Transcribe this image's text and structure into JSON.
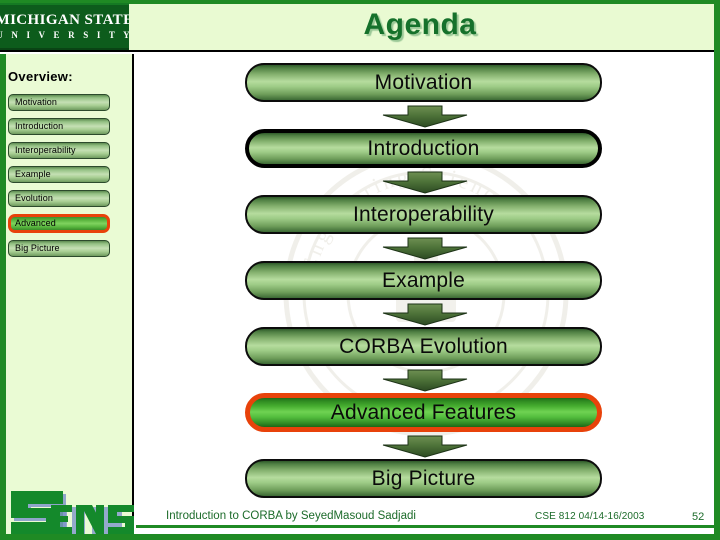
{
  "header": {
    "title": "Agenda",
    "logo": {
      "line1": "MICHIGAN STATE",
      "line2": "U N I V E R S I T Y",
      "alt": "michigan-state-university-logo"
    }
  },
  "sidebar": {
    "heading": "Overview:",
    "items": [
      {
        "label": "Motivation",
        "active": false
      },
      {
        "label": "Introduction",
        "active": false
      },
      {
        "label": "Interoperability",
        "active": false
      },
      {
        "label": "Example",
        "active": false
      },
      {
        "label": "Evolution",
        "active": false
      },
      {
        "label": "Advanced",
        "active": true
      },
      {
        "label": "Big Picture",
        "active": false
      }
    ],
    "logo_text": "SENS"
  },
  "flow": {
    "boxes": [
      {
        "label": "Motivation",
        "style": "normal"
      },
      {
        "label": "Introduction",
        "style": "thick"
      },
      {
        "label": "Interoperability",
        "style": "normal"
      },
      {
        "label": "Example",
        "style": "normal"
      },
      {
        "label": "CORBA Evolution",
        "style": "normal"
      },
      {
        "label": "Advanced Features",
        "style": "highlight"
      },
      {
        "label": "Big Picture",
        "style": "normal"
      }
    ],
    "arrow_icon": "down-arrow-icon"
  },
  "footer": {
    "main": "Introduction to CORBA by SeyedMasoud Sadjadi",
    "course": "CSE 812   04/14-16/2003",
    "page": "52"
  },
  "colors": {
    "brand_green": "#1f8a24",
    "title_green": "#15712b",
    "header_band": "#e9fad2",
    "sidebar_bg": "#eafbd4",
    "highlight_orange": "#e8420a",
    "box_green_mid": "#b6dc9e",
    "msu_dark_green": "#0d5c1c"
  }
}
